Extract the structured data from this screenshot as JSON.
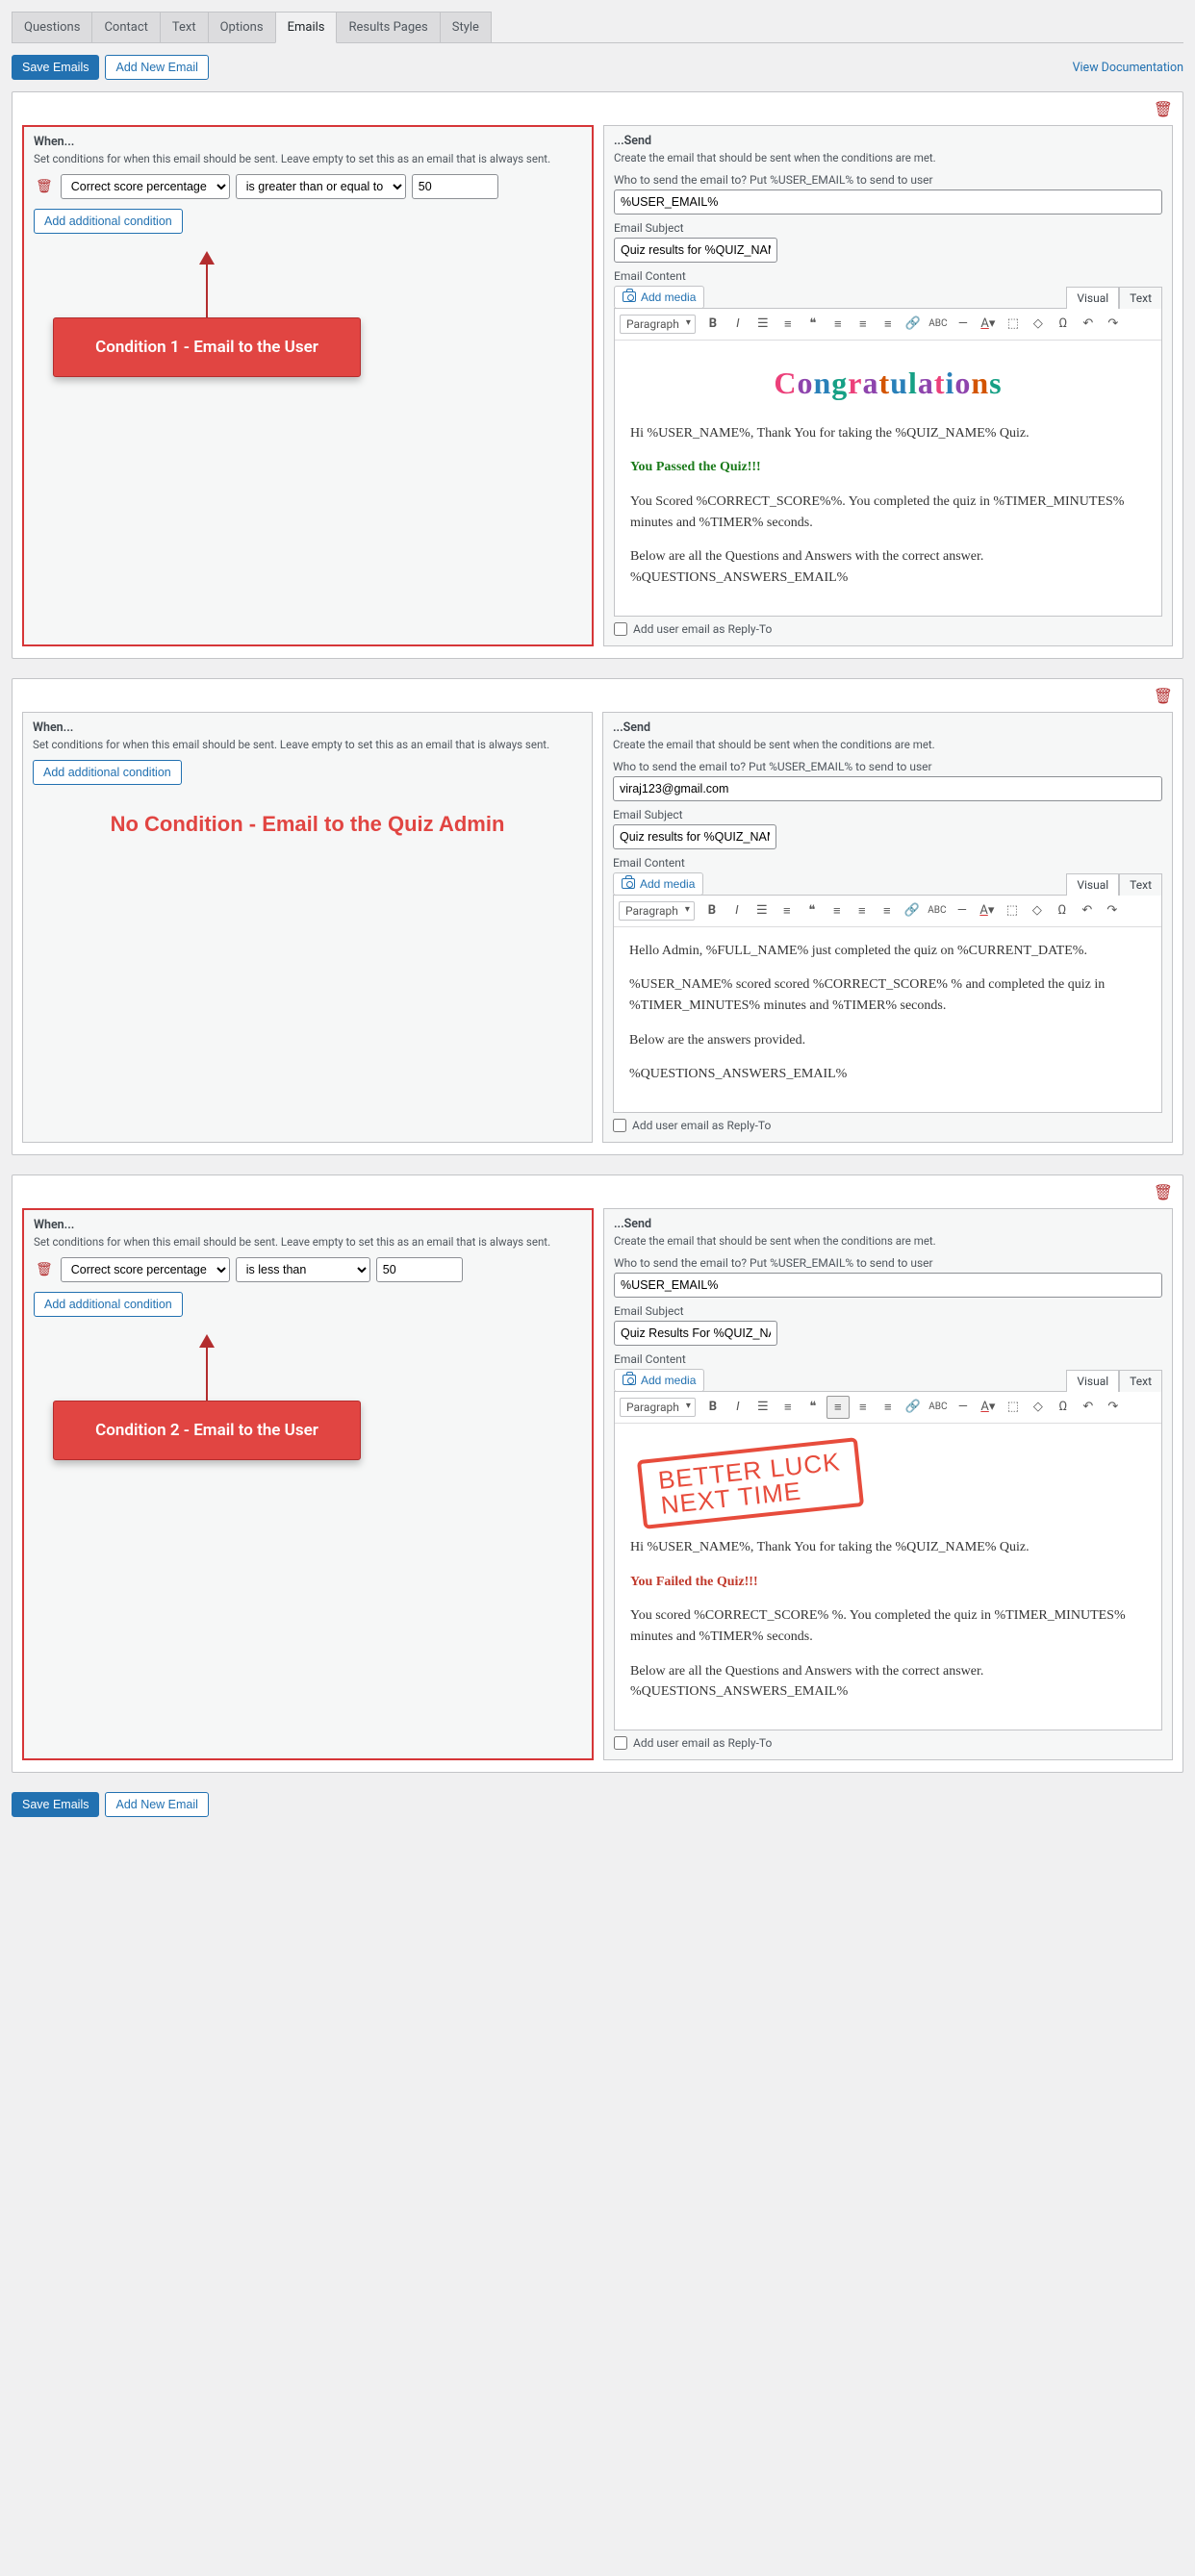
{
  "tabs": [
    "Questions",
    "Contact",
    "Text",
    "Options",
    "Emails",
    "Results Pages",
    "Style"
  ],
  "activeTab": 4,
  "saveBtn": "Save Emails",
  "addBtn": "Add New Email",
  "docLink": "View Documentation",
  "when": {
    "title": "When...",
    "desc_long": "Set conditions for when this email should be sent. Leave empty to set this as an email that is always sent.",
    "desc_short": "Set conditions for when this email should be sent. Leave empty to set this as an email that is always sent.",
    "addCond": "Add additional condition",
    "fieldOpt": "Correct score percentage",
    "opGreater": "is greater than or equal to",
    "opLess": "is less than",
    "val": "50"
  },
  "send": {
    "title": "...Send",
    "desc": "Create the email that should be sent when the conditions are met.",
    "toLabel": "Who to send the email to? Put %USER_EMAIL% to send to user",
    "subjectLabel": "Email Subject",
    "contentLabel": "Email Content",
    "addMedia": "Add media",
    "visual": "Visual",
    "text": "Text",
    "paragraph": "Paragraph",
    "replyTo": "Add user email as Reply-To"
  },
  "email1": {
    "to": "%USER_EMAIL%",
    "subject": "Quiz results for %QUIZ_NAME%",
    "congrats": "Congratulations",
    "p1": "Hi %USER_NAME%, Thank You for taking the %QUIZ_NAME% Quiz.",
    "p2": "You Passed the Quiz!!!",
    "p3": "You Scored %CORRECT_SCORE%%. You completed the quiz in %TIMER_MINUTES% minutes and %TIMER% seconds.",
    "p4": "Below are all the Questions and Answers with the correct answer. %QUESTIONS_ANSWERS_EMAIL%"
  },
  "email2": {
    "to": "viraj123@gmail.com",
    "subject": "Quiz results for %QUIZ_NAME%",
    "p1": "Hello Admin, %FULL_NAME% just completed the quiz on %CURRENT_DATE%.",
    "p2": "%USER_NAME% scored scored %CORRECT_SCORE% % and completed the quiz in %TIMER_MINUTES% minutes and %TIMER% seconds.",
    "p3": "Below are the answers provided.",
    "p4": "%QUESTIONS_ANSWERS_EMAIL%"
  },
  "email3": {
    "to": "%USER_EMAIL%",
    "subject": "Quiz Results For %QUIZ_NAME%",
    "stamp1": "BETTER LUCK",
    "stamp2": "NEXT TIME",
    "p1": "Hi %USER_NAME%, Thank You for taking the %QUIZ_NAME% Quiz.",
    "p2": "You Failed the Quiz!!!",
    "p3": "You scored %CORRECT_SCORE% %. You completed the quiz in %TIMER_MINUTES% minutes and %TIMER% seconds.",
    "p4": "Below are all the Questions and Answers with the correct answer. %QUESTIONS_ANSWERS_EMAIL%"
  },
  "annot": {
    "c1": "Condition 1  -  Email to the User",
    "free": "No Condition - Email to the Quiz Admin",
    "c2": "Condition 2  -  Email to the User"
  }
}
